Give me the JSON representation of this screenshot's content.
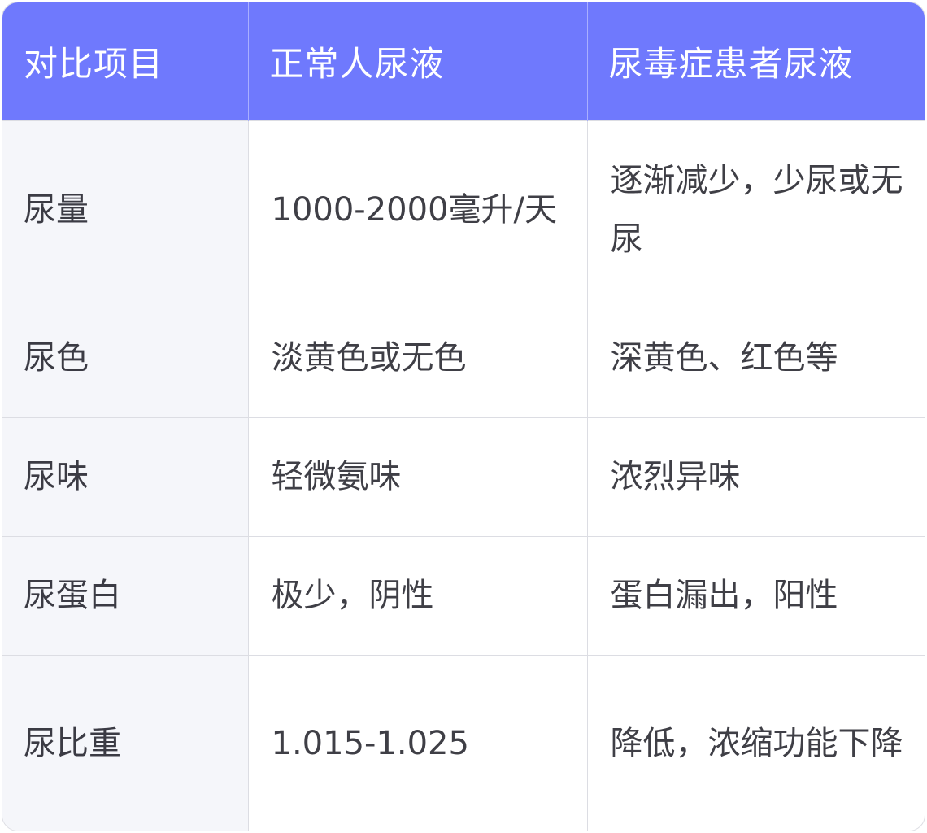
{
  "table": {
    "headers": [
      "对比项目",
      "正常人尿液",
      "尿毒症患者尿液"
    ],
    "rows": [
      [
        "尿量",
        "1000-2000毫升/天",
        "逐渐减少，少尿或无尿"
      ],
      [
        "尿色",
        "淡黄色或无色",
        "深黄色、红色等"
      ],
      [
        "尿味",
        "轻微氨味",
        "浓烈异味"
      ],
      [
        "尿蛋白",
        "极少，阴性",
        "蛋白漏出，阳性"
      ],
      [
        "尿比重",
        "1.015-1.025",
        "降低，浓缩功能下降"
      ]
    ]
  },
  "colors": {
    "header_bg": "#6f79fd",
    "header_text": "#ffffff",
    "label_bg": "#f5f6fa",
    "border": "#dcdde3",
    "body_text": "#3f3f46"
  }
}
